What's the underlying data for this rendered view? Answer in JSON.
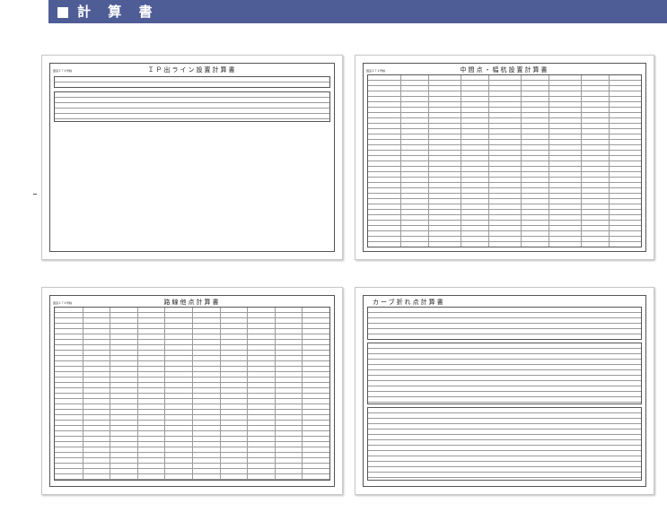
{
  "header": {
    "title": "計 算 書"
  },
  "panels": [
    {
      "id": "ip",
      "title": "ＩＰ出ライン設置計算書",
      "left_note": "国道２７４号線",
      "right_note": ""
    },
    {
      "id": "intermediate",
      "title": "中間点・幅杭設置計算書",
      "left_note": "国道２７４号線",
      "right_note": ""
    },
    {
      "id": "route",
      "title": "路線他点計算書",
      "left_note": "国道２７４号線",
      "right_note": ""
    },
    {
      "id": "curve",
      "title": "カーブ折れ点計算書",
      "left_note": "",
      "right_note": ""
    }
  ]
}
